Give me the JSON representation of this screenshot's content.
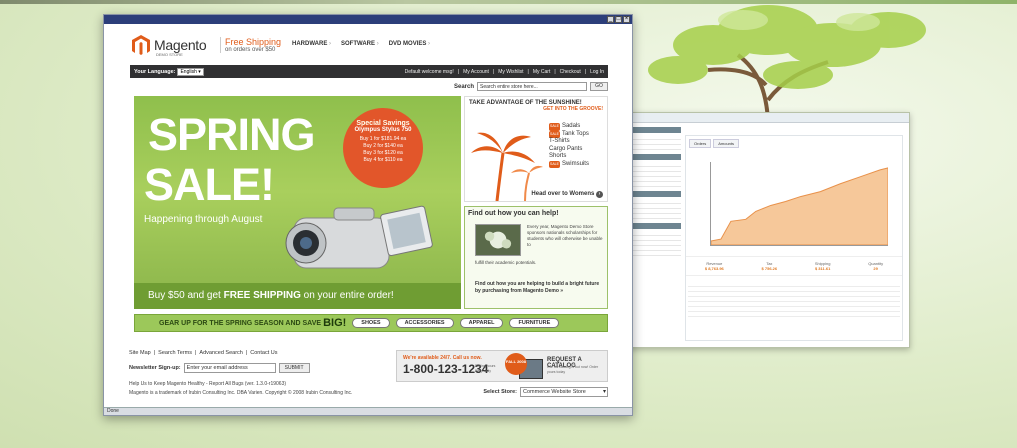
{
  "browser": {
    "status": "Done",
    "buttons": [
      "_",
      "□",
      "×"
    ]
  },
  "header": {
    "logo_text": "Magento",
    "logo_sub": "DEMO STORE",
    "free_shipping_title": "Free Shipping",
    "free_shipping_sub": "on orders over $50",
    "nav": [
      "HARDWARE",
      "SOFTWARE",
      "DVD MOVIES"
    ]
  },
  "topbar": {
    "language_label": "Your Language:",
    "language_value": "English",
    "welcome": "Default welcome msg!",
    "links": [
      "My Account",
      "My Wishlist",
      "My Cart",
      "Checkout",
      "Log In"
    ]
  },
  "search": {
    "label": "Search",
    "placeholder": "Search entire store here...",
    "button": "GO"
  },
  "hero": {
    "line1": "SPRING",
    "line2": "SALE!",
    "subtitle": "Happening through August",
    "offer_title": "Special Savings",
    "offer_product": "Olympus Stylus 750",
    "offers": [
      "Buy 1 for $181.94 ea",
      "Buy 2 for $140 ea",
      "Buy 3 for $120 ea",
      "Buy 4 for $110 ea"
    ],
    "bottom_prefix": "Buy $50 and get ",
    "bottom_bold": "FREE SHIPPING",
    "bottom_suffix": " on your entire order!"
  },
  "promo_sunshine": {
    "title": "TAKE ADVANTAGE OF THE SUNSHINE!",
    "subtitle": "GET INTO THE GROOVE!",
    "sale_tag": "SALE",
    "items": [
      "Sadals",
      "Tank Tops",
      "T-Shirts",
      "Cargo Pants",
      "Shorts",
      "Swimsuits"
    ],
    "footer": "Head over to Womens"
  },
  "promo_help": {
    "title": "Find out how you can help!",
    "body": "Every year, Magento Demo Store sponsors nationals scholarships for students who will otherwise be unable to",
    "body2": "fulfill their academic potentials.",
    "link": "Find out how you are helping to build a bright future by purchasing from Magento Demo »"
  },
  "gearbar": {
    "text": "GEAR UP FOR THE SPRING SEASON AND SAVE",
    "big": "BIG!",
    "buttons": [
      "SHOES",
      "ACCESSORIES",
      "APPAREL",
      "FURNITURE"
    ]
  },
  "footer": {
    "links": [
      "Site Map",
      "Search Terms",
      "Advanced Search",
      "Contact Us"
    ],
    "newsletter_label": "Newsletter Sign-up:",
    "newsletter_placeholder": "Enter your email address",
    "newsletter_button": "SUBMIT",
    "help": "Help Us to Keep Magento Healthy - Report All Bugs (ver. 1.3.0-r19063)",
    "copyright": "Magento is a trademark of Irubin Consulting Inc. DBA Varien. Copyright © 2008 Irubin Consulting Inc.",
    "phone_avail": "We're available 24/7. Call us now.",
    "phone": "1-800-123-1234",
    "phone_hours": "Rolling hours Daily daily",
    "fall_badge": "FALL 2008",
    "catalog_title": "REQUEST A CATALOG",
    "catalog_sub": "Our fall catalog is out now! Order yours today",
    "store_label": "Select Store:",
    "store_value": "Commerce Website Store"
  },
  "admin": {
    "tabs": [
      "Orders",
      "Amounts"
    ],
    "stats": [
      {
        "label": "Revenue",
        "value": "$ 8,763.96"
      },
      {
        "label": "Tax",
        "value": "$ 756.26"
      },
      {
        "label": "Shipping",
        "value": "$ 311.61"
      },
      {
        "label": "Quantity",
        "value": "29"
      }
    ]
  },
  "colors": {
    "hero_green": "#8fbf4c",
    "accent_orange": "#e05c1a",
    "dark_bar": "#303032",
    "titlebar": "#2c3e7a"
  }
}
